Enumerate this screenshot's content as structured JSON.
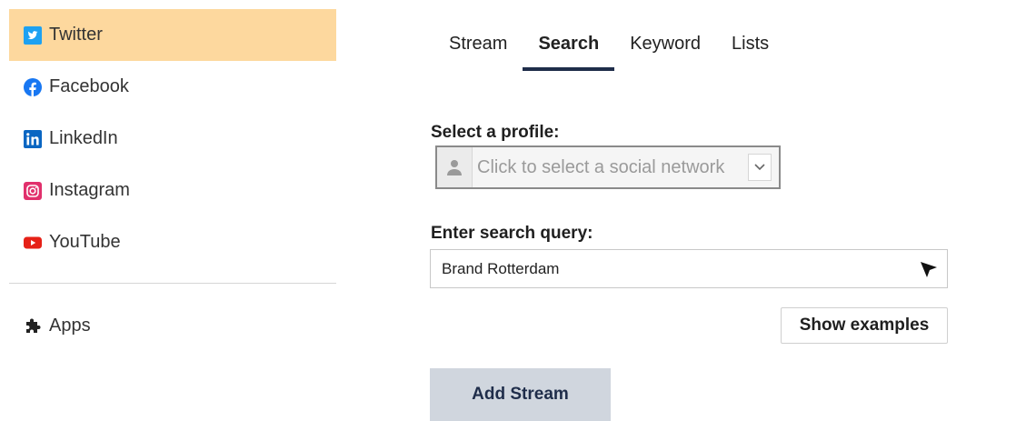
{
  "sidebar": {
    "items": [
      {
        "label": "Twitter",
        "icon": "twitter-icon",
        "color": "#1da1f2",
        "active": true
      },
      {
        "label": "Facebook",
        "icon": "facebook-icon",
        "color": "#1877f2",
        "active": false
      },
      {
        "label": "LinkedIn",
        "icon": "linkedin-icon",
        "color": "#0a66c2",
        "active": false
      },
      {
        "label": "Instagram",
        "icon": "instagram-icon",
        "color": "#e1306c",
        "active": false
      },
      {
        "label": "YouTube",
        "icon": "youtube-icon",
        "color": "#e62117",
        "active": false
      }
    ],
    "apps": {
      "label": "Apps",
      "icon": "puzzle-icon"
    }
  },
  "tabs": [
    {
      "label": "Stream",
      "active": false
    },
    {
      "label": "Search",
      "active": true
    },
    {
      "label": "Keyword",
      "active": false
    },
    {
      "label": "Lists",
      "active": false
    }
  ],
  "form": {
    "profile_label": "Select a profile:",
    "profile_placeholder": "Click to select a social network",
    "query_label": "Enter search query:",
    "query_value": "Brand Rotterdam",
    "show_examples": "Show examples",
    "add_stream": "Add Stream"
  },
  "colors": {
    "active_bg": "#fdd89e",
    "tab_underline": "#1f2d4a",
    "add_button_bg": "#d0d6de"
  }
}
